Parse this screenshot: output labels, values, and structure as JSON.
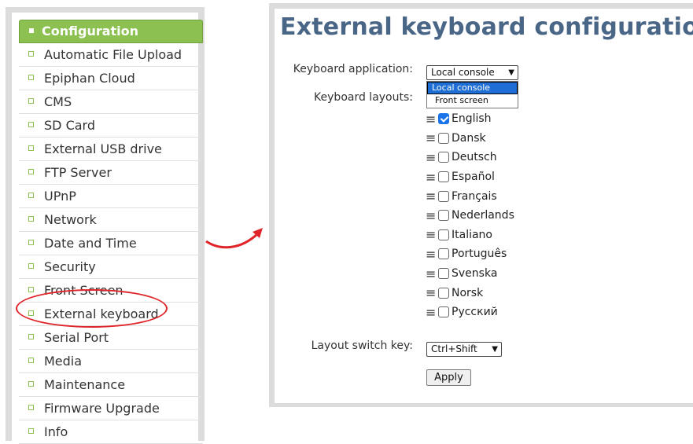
{
  "sidebar": {
    "header": "Configuration",
    "items": [
      {
        "label": "Automatic File Upload"
      },
      {
        "label": "Epiphan Cloud"
      },
      {
        "label": "CMS"
      },
      {
        "label": "SD Card"
      },
      {
        "label": "External USB drive"
      },
      {
        "label": "FTP Server"
      },
      {
        "label": "UPnP"
      },
      {
        "label": "Network"
      },
      {
        "label": "Date and Time"
      },
      {
        "label": "Security"
      },
      {
        "label": "Front Screen"
      },
      {
        "label": "External keyboard"
      },
      {
        "label": "Serial Port"
      },
      {
        "label": "Media"
      },
      {
        "label": "Maintenance"
      },
      {
        "label": "Firmware Upgrade"
      },
      {
        "label": "Info"
      }
    ]
  },
  "main": {
    "title": "External keyboard configuration",
    "keyboard_application": {
      "label": "Keyboard application:",
      "value": "Local console",
      "options": [
        "Local console",
        "Front screen"
      ]
    },
    "keyboard_layouts": {
      "label": "Keyboard layouts:",
      "items": [
        {
          "name": "English",
          "checked": true
        },
        {
          "name": "Dansk",
          "checked": false
        },
        {
          "name": "Deutsch",
          "checked": false
        },
        {
          "name": "Español",
          "checked": false
        },
        {
          "name": "Français",
          "checked": false
        },
        {
          "name": "Nederlands",
          "checked": false
        },
        {
          "name": "Italiano",
          "checked": false
        },
        {
          "name": "Português",
          "checked": false
        },
        {
          "name": "Svenska",
          "checked": false
        },
        {
          "name": "Norsk",
          "checked": false
        },
        {
          "name": "Русский",
          "checked": false
        }
      ]
    },
    "layout_switch_key": {
      "label": "Layout switch key:",
      "value": "Ctrl+Shift"
    },
    "apply_label": "Apply"
  },
  "icons": {
    "drag_handle": "≡",
    "caret": "▼"
  },
  "colors": {
    "accent_green": "#8cc152",
    "title_blue": "#4a6687",
    "annotation_red": "#e0252a",
    "checkbox_blue": "#1a73e8"
  }
}
